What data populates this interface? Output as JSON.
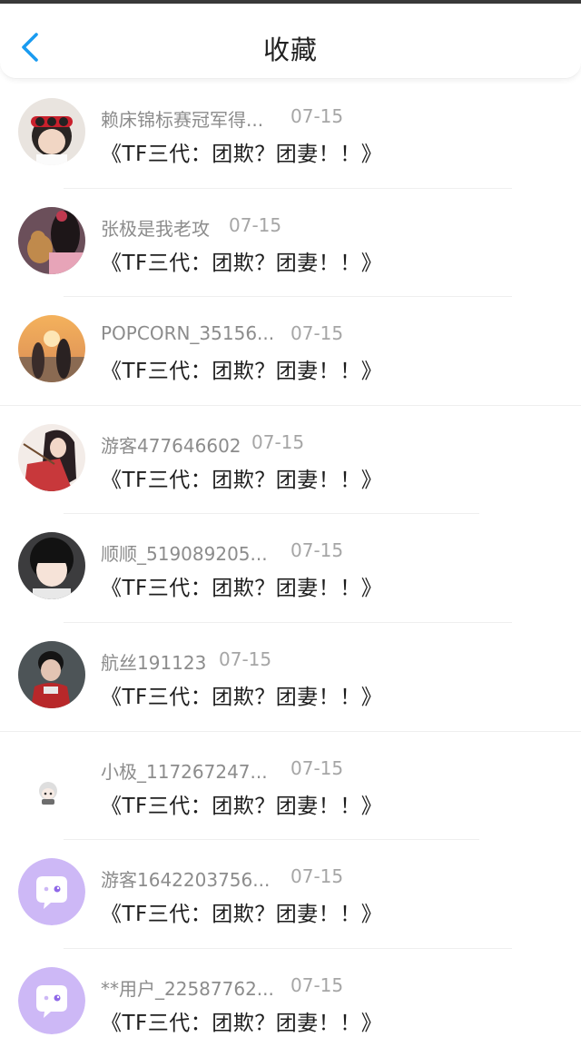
{
  "header": {
    "title": "收藏"
  },
  "items": [
    {
      "name": "赖床锦标赛冠军得...",
      "date": "07-15",
      "content": "《TF三代：团欺？团妻！！》"
    },
    {
      "name": "张极是我老攻",
      "date": "07-15",
      "content": "《TF三代：团欺？团妻！！》"
    },
    {
      "name": "POPCORN_35156...",
      "date": "07-15",
      "content": "《TF三代：团欺？团妻！！》"
    },
    {
      "name": "游客477646602",
      "date": "07-15",
      "content": "《TF三代：团欺？团妻！！》"
    },
    {
      "name": "顺顺_519089205...",
      "date": "07-15",
      "content": "《TF三代：团欺？团妻！！》"
    },
    {
      "name": "航丝191123",
      "date": "07-15",
      "content": "《TF三代：团欺？团妻！！》"
    },
    {
      "name": "小极_117267247...",
      "date": "07-15",
      "content": "《TF三代：团欺？团妻！！》"
    },
    {
      "name": "游客1642203756...",
      "date": "07-15",
      "content": "《TF三代：团欺？团妻！！》"
    },
    {
      "name": "**用户_22587762...",
      "date": "07-15",
      "content": "《TF三代：团欺？团妻！！》"
    }
  ],
  "colors": {
    "accent": "#1a9bf0",
    "default_avatar_bg": "#cdb8f6"
  }
}
